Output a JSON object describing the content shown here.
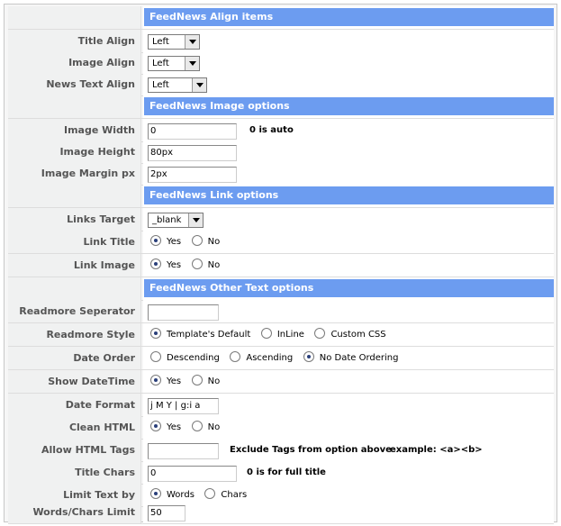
{
  "sections": {
    "align": "FeedNews Align items",
    "image": "FeedNews Image options",
    "link": "FeedNews Link options",
    "other": "FeedNews Other Text options"
  },
  "fields": {
    "title_align": {
      "label": "Title Align",
      "value": "Left"
    },
    "image_align": {
      "label": "Image Align",
      "value": "Left"
    },
    "news_text_align": {
      "label": "News Text Align",
      "value": "Left"
    },
    "image_width": {
      "label": "Image Width",
      "value": "0",
      "note": "0 is auto"
    },
    "image_height": {
      "label": "Image Height",
      "value": "80px"
    },
    "image_margin": {
      "label": "Image Margin px",
      "value": "2px"
    },
    "links_target": {
      "label": "Links Target",
      "value": "_blank"
    },
    "link_title": {
      "label": "Link Title",
      "options": [
        "Yes",
        "No"
      ],
      "selected": "Yes"
    },
    "link_image": {
      "label": "Link Image",
      "options": [
        "Yes",
        "No"
      ],
      "selected": "Yes"
    },
    "readmore_sep": {
      "label": "Readmore Seperator",
      "value": ""
    },
    "readmore_style": {
      "label": "Readmore Style",
      "options": [
        "Template's Default",
        "InLine",
        "Custom CSS"
      ],
      "selected": "Template's Default"
    },
    "date_order": {
      "label": "Date Order",
      "options": [
        "Descending",
        "Ascending",
        "No Date Ordering"
      ],
      "selected": "No Date Ordering"
    },
    "show_datetime": {
      "label": "Show DateTime",
      "options": [
        "Yes",
        "No"
      ],
      "selected": "Yes"
    },
    "date_format": {
      "label": "Date Format",
      "value": "j M Y | g:i a"
    },
    "clean_html": {
      "label": "Clean HTML",
      "options": [
        "Yes",
        "No"
      ],
      "selected": "Yes"
    },
    "allow_html_tags": {
      "label": "Allow HTML Tags",
      "value": "",
      "note": "Exclude Tags from option above",
      "example": "example: <a><b>"
    },
    "title_chars": {
      "label": "Title Chars",
      "value": "0",
      "note": "0 is for full title"
    },
    "limit_text_by": {
      "label": "Limit Text by",
      "options": [
        "Words",
        "Chars"
      ],
      "selected": "Words"
    },
    "limit": {
      "label": "Words/Chars Limit",
      "value": "50"
    }
  }
}
